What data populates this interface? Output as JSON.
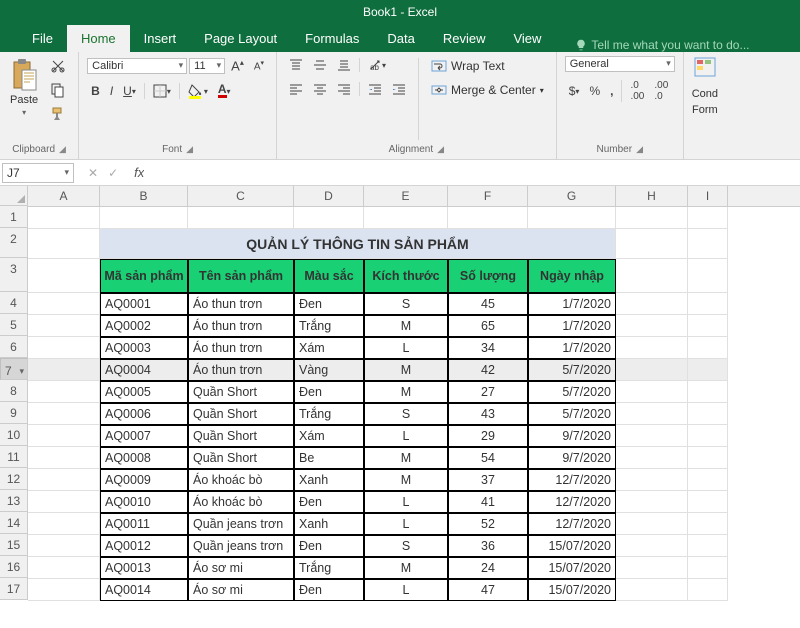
{
  "app": {
    "title": "Book1 - Excel"
  },
  "tabs": [
    "File",
    "Home",
    "Insert",
    "Page Layout",
    "Formulas",
    "Data",
    "Review",
    "View"
  ],
  "tell_me": "Tell me what you want to do...",
  "ribbon": {
    "paste_label": "Paste",
    "clipboard_label": "Clipboard",
    "font_name": "Calibri",
    "font_size": "11",
    "font_label": "Font",
    "wrap_text": "Wrap Text",
    "merge_center": "Merge & Center",
    "alignment_label": "Alignment",
    "number_format": "General",
    "number_label": "Number",
    "cond_label1": "Cond",
    "cond_label2": "Form"
  },
  "namebox": "J7",
  "fx": "fx",
  "sheet": {
    "columns": [
      "A",
      "B",
      "C",
      "D",
      "E",
      "F",
      "G",
      "H",
      "I"
    ],
    "row_count": 17,
    "title": "QUẢN LÝ THÔNG TIN SẢN PHẨM",
    "headers": [
      "Mã sản phẩm",
      "Tên sản phẩm",
      "Màu sắc",
      "Kích thước",
      "Số lượng",
      "Ngày nhập"
    ],
    "rows": [
      {
        "ma": "AQ0001",
        "ten": "Áo thun trơn",
        "mau": "Đen",
        "kt": "S",
        "sl": "45",
        "ngay": "1/7/2020"
      },
      {
        "ma": "AQ0002",
        "ten": "Áo thun trơn",
        "mau": "Trắng",
        "kt": "M",
        "sl": "65",
        "ngay": "1/7/2020"
      },
      {
        "ma": "AQ0003",
        "ten": "Áo thun trơn",
        "mau": "Xám",
        "kt": "L",
        "sl": "34",
        "ngay": "1/7/2020"
      },
      {
        "ma": "AQ0004",
        "ten": "Áo thun trơn",
        "mau": "Vàng",
        "kt": "M",
        "sl": "42",
        "ngay": "5/7/2020"
      },
      {
        "ma": "AQ0005",
        "ten": "Quần Short",
        "mau": "Đen",
        "kt": "M",
        "sl": "27",
        "ngay": "5/7/2020"
      },
      {
        "ma": "AQ0006",
        "ten": "Quần Short",
        "mau": "Trắng",
        "kt": "S",
        "sl": "43",
        "ngay": "5/7/2020"
      },
      {
        "ma": "AQ0007",
        "ten": "Quần Short",
        "mau": "Xám",
        "kt": "L",
        "sl": "29",
        "ngay": "9/7/2020"
      },
      {
        "ma": "AQ0008",
        "ten": "Quần Short",
        "mau": "Be",
        "kt": "M",
        "sl": "54",
        "ngay": "9/7/2020"
      },
      {
        "ma": "AQ0009",
        "ten": "Áo khoác bò",
        "mau": "Xanh",
        "kt": "M",
        "sl": "37",
        "ngay": "12/7/2020"
      },
      {
        "ma": "AQ0010",
        "ten": "Áo khoác bò",
        "mau": "Đen",
        "kt": "L",
        "sl": "41",
        "ngay": "12/7/2020"
      },
      {
        "ma": "AQ0011",
        "ten": "Quần jeans trơn",
        "mau": "Xanh",
        "kt": "L",
        "sl": "52",
        "ngay": "12/7/2020"
      },
      {
        "ma": "AQ0012",
        "ten": "Quần jeans trơn",
        "mau": "Đen",
        "kt": "S",
        "sl": "36",
        "ngay": "15/07/2020"
      },
      {
        "ma": "AQ0013",
        "ten": "Áo sơ mi",
        "mau": "Trắng",
        "kt": "M",
        "sl": "24",
        "ngay": "15/07/2020"
      },
      {
        "ma": "AQ0014",
        "ten": "Áo sơ mi",
        "mau": "Đen",
        "kt": "L",
        "sl": "47",
        "ngay": "15/07/2020"
      }
    ],
    "selected_row_index": 3
  }
}
